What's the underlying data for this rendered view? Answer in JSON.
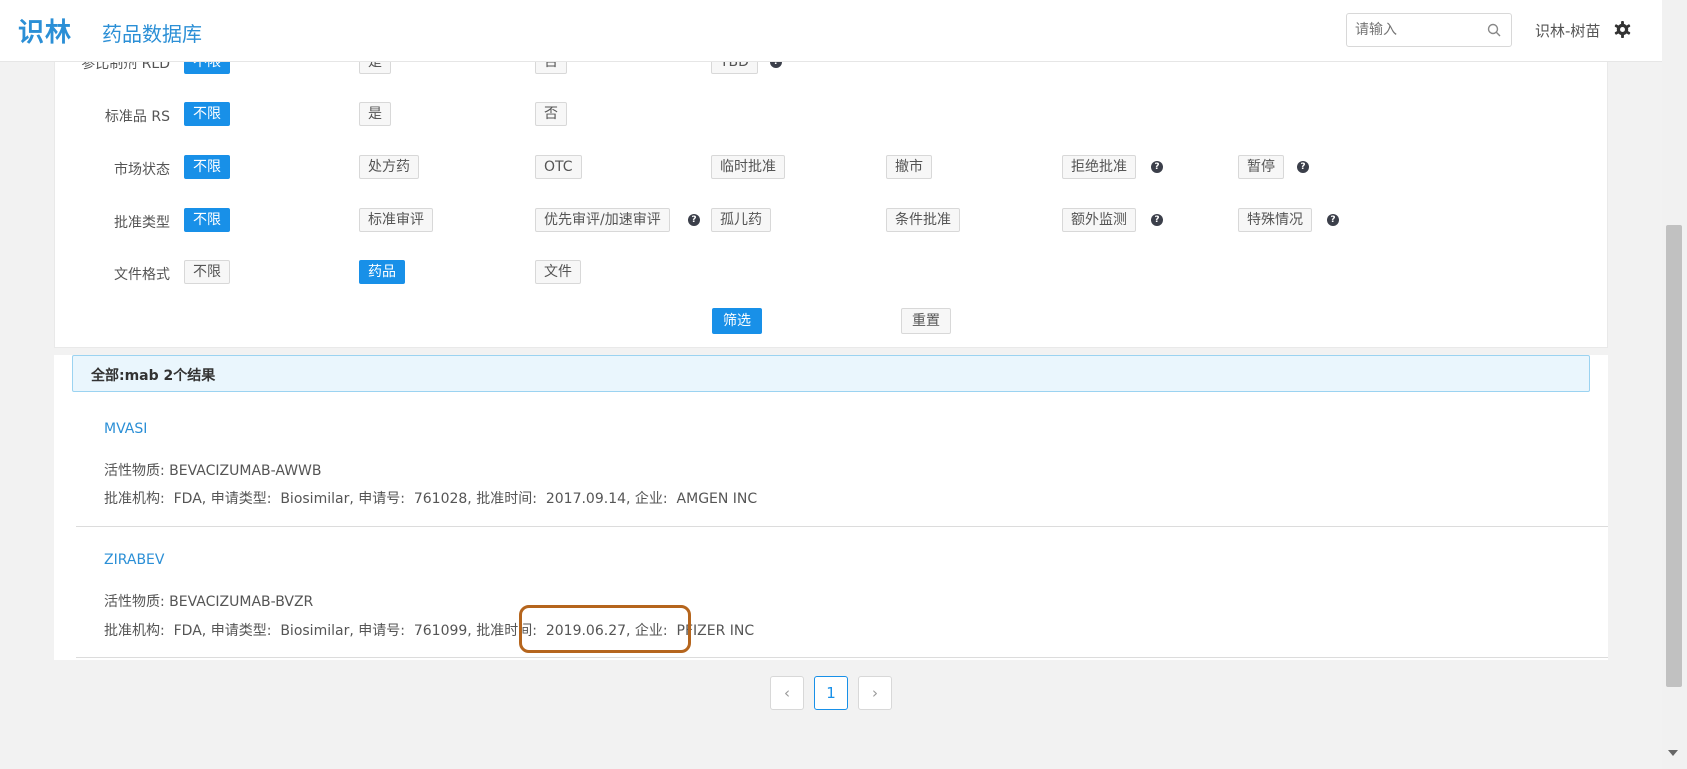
{
  "header": {
    "logo": "识林",
    "title": "药品数据库",
    "search_placeholder": "请输入",
    "user": "识林-树苗"
  },
  "filters": {
    "row_rld": {
      "label": "参比制剂 RLD",
      "options": [
        "不限",
        "是",
        "否",
        "TBD"
      ]
    },
    "row_rs": {
      "label": "标准品 RS",
      "options": [
        "不限",
        "是",
        "否"
      ]
    },
    "row_market": {
      "label": "市场状态",
      "options": [
        "不限",
        "处方药",
        "OTC",
        "临时批准",
        "撤市",
        "拒绝批准",
        "暂停"
      ]
    },
    "row_approval": {
      "label": "批准类型",
      "options": [
        "不限",
        "标准审评",
        "优先审评/加速审评",
        "孤儿药",
        "条件批准",
        "额外监测",
        "特殊情况"
      ]
    },
    "row_format": {
      "label": "文件格式",
      "options": [
        "不限",
        "药品",
        "文件"
      ]
    },
    "filter_button": "筛选",
    "reset_button": "重置",
    "help_glyph": "?"
  },
  "results": {
    "summary": "全部:mab  2个结果",
    "items": [
      {
        "name": "MVASI",
        "active_label": "活性物质:",
        "active": "BEVACIZUMAB-AWWB",
        "agency_label": "批准机构:",
        "agency": "FDA,",
        "type_label": "申请类型:",
        "type": "Biosimilar,",
        "app_label": "申请号:",
        "app_no": "761028,",
        "date_label": "批准时间:",
        "date": "2017.09.14,",
        "company_label": "企业:",
        "company": "AMGEN INC"
      },
      {
        "name": "ZIRABEV",
        "active_label": "活性物质:",
        "active": "BEVACIZUMAB-BVZR",
        "agency_label": "批准机构:",
        "agency": "FDA,",
        "type_label": "申请类型:",
        "type": "Biosimilar,",
        "app_label": "申请号:",
        "app_no": "761099,",
        "date_label": "批准时间:",
        "date": "2019.06.27,",
        "company_label": "企业:",
        "company": "PFIZER INC"
      }
    ]
  },
  "pagination": {
    "prev": "‹",
    "current": "1",
    "next": "›"
  },
  "colors": {
    "accent": "#1890e8",
    "brand": "#2b8fd6",
    "highlight": "#b5651d"
  }
}
